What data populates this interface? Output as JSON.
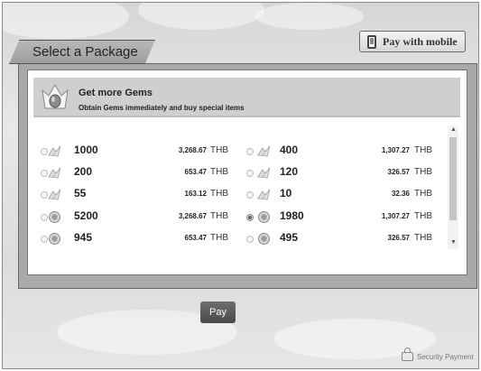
{
  "header": {
    "tab_title": "Select a Package",
    "mobile_button_label": "Pay with mobile"
  },
  "banner": {
    "title": "Get more Gems",
    "subtitle": "Obtain Gems immediately and buy special items"
  },
  "packages": [
    {
      "amount": "1000",
      "price": "3,268.67",
      "currency": "THB",
      "icon": "gem-stack-icon",
      "selected": false
    },
    {
      "amount": "400",
      "price": "1,307.27",
      "currency": "THB",
      "icon": "gem-stack-icon",
      "selected": false
    },
    {
      "amount": "200",
      "price": "653.47",
      "currency": "THB",
      "icon": "gem-stack-icon",
      "selected": false
    },
    {
      "amount": "120",
      "price": "326.57",
      "currency": "THB",
      "icon": "gem-stack-icon",
      "selected": false
    },
    {
      "amount": "55",
      "price": "163.12",
      "currency": "THB",
      "icon": "gem-stack-icon",
      "selected": false
    },
    {
      "amount": "10",
      "price": "32.36",
      "currency": "THB",
      "icon": "gem-stack-icon",
      "selected": false
    },
    {
      "amount": "5200",
      "price": "3,268.67",
      "currency": "THB",
      "icon": "coin-icon",
      "selected": false
    },
    {
      "amount": "1980",
      "price": "1,307.27",
      "currency": "THB",
      "icon": "coin-icon",
      "selected": true
    },
    {
      "amount": "945",
      "price": "653.47",
      "currency": "THB",
      "icon": "coin-icon",
      "selected": false
    },
    {
      "amount": "495",
      "price": "326.57",
      "currency": "THB",
      "icon": "coin-icon",
      "selected": false
    }
  ],
  "footer": {
    "pay_label": "Pay",
    "security_label": "Security Payment"
  }
}
